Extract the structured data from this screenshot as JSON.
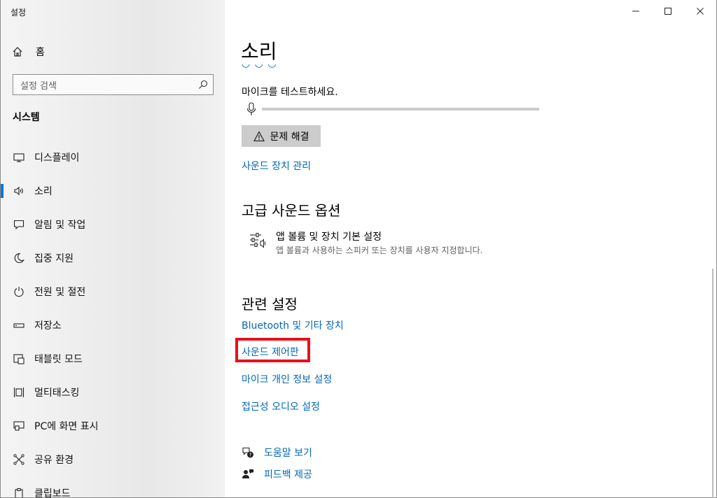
{
  "window": {
    "title": "설정",
    "controls": {
      "minimize": "minimize-icon",
      "maximize": "maximize-icon",
      "close": "close-icon"
    }
  },
  "sidebar": {
    "home_label": "홈",
    "search_placeholder": "설정 검색",
    "section_title": "시스템",
    "items": [
      {
        "label": "디스플레이",
        "icon": "monitor-icon",
        "active": false
      },
      {
        "label": "소리",
        "icon": "speaker-icon",
        "active": true
      },
      {
        "label": "알림 및 작업",
        "icon": "message-icon",
        "active": false
      },
      {
        "label": "집중 지원",
        "icon": "moon-icon",
        "active": false
      },
      {
        "label": "전원 및 절전",
        "icon": "power-icon",
        "active": false
      },
      {
        "label": "저장소",
        "icon": "storage-icon",
        "active": false
      },
      {
        "label": "태블릿 모드",
        "icon": "tablet-icon",
        "active": false
      },
      {
        "label": "멀티태스킹",
        "icon": "multitask-icon",
        "active": false
      },
      {
        "label": "PC에 화면 표시",
        "icon": "project-icon",
        "active": false
      },
      {
        "label": "공유 환경",
        "icon": "share-icon",
        "active": false
      },
      {
        "label": "클립보드",
        "icon": "clipboard-icon",
        "active": false
      }
    ]
  },
  "main": {
    "title": "소리",
    "mic_test_label": "마이크를 테스트하세요.",
    "mic_level": 0,
    "troubleshoot_label": "문제 해결",
    "manage_devices_link": "사운드 장치 관리",
    "advanced": {
      "heading": "고급 사운드 옵션",
      "app_volume_title": "앱 볼륨 및 장치 기본 설정",
      "app_volume_desc": "앱 볼륨과 사용하는 스피커 또는 장치를 사용자 지정합니다."
    },
    "related": {
      "heading": "관련 설정",
      "links": [
        "Bluetooth 및 기타 장치",
        "사운드 제어판",
        "마이크 개인 정보 설정",
        "접근성 오디오 설정"
      ],
      "highlighted_index": 1
    },
    "help": {
      "get_help": "도움말 보기",
      "feedback": "피드백 제공"
    }
  },
  "colors": {
    "accent": "#0067b8",
    "active_indicator": "#0078d7",
    "highlight_box": "#e8101a"
  }
}
